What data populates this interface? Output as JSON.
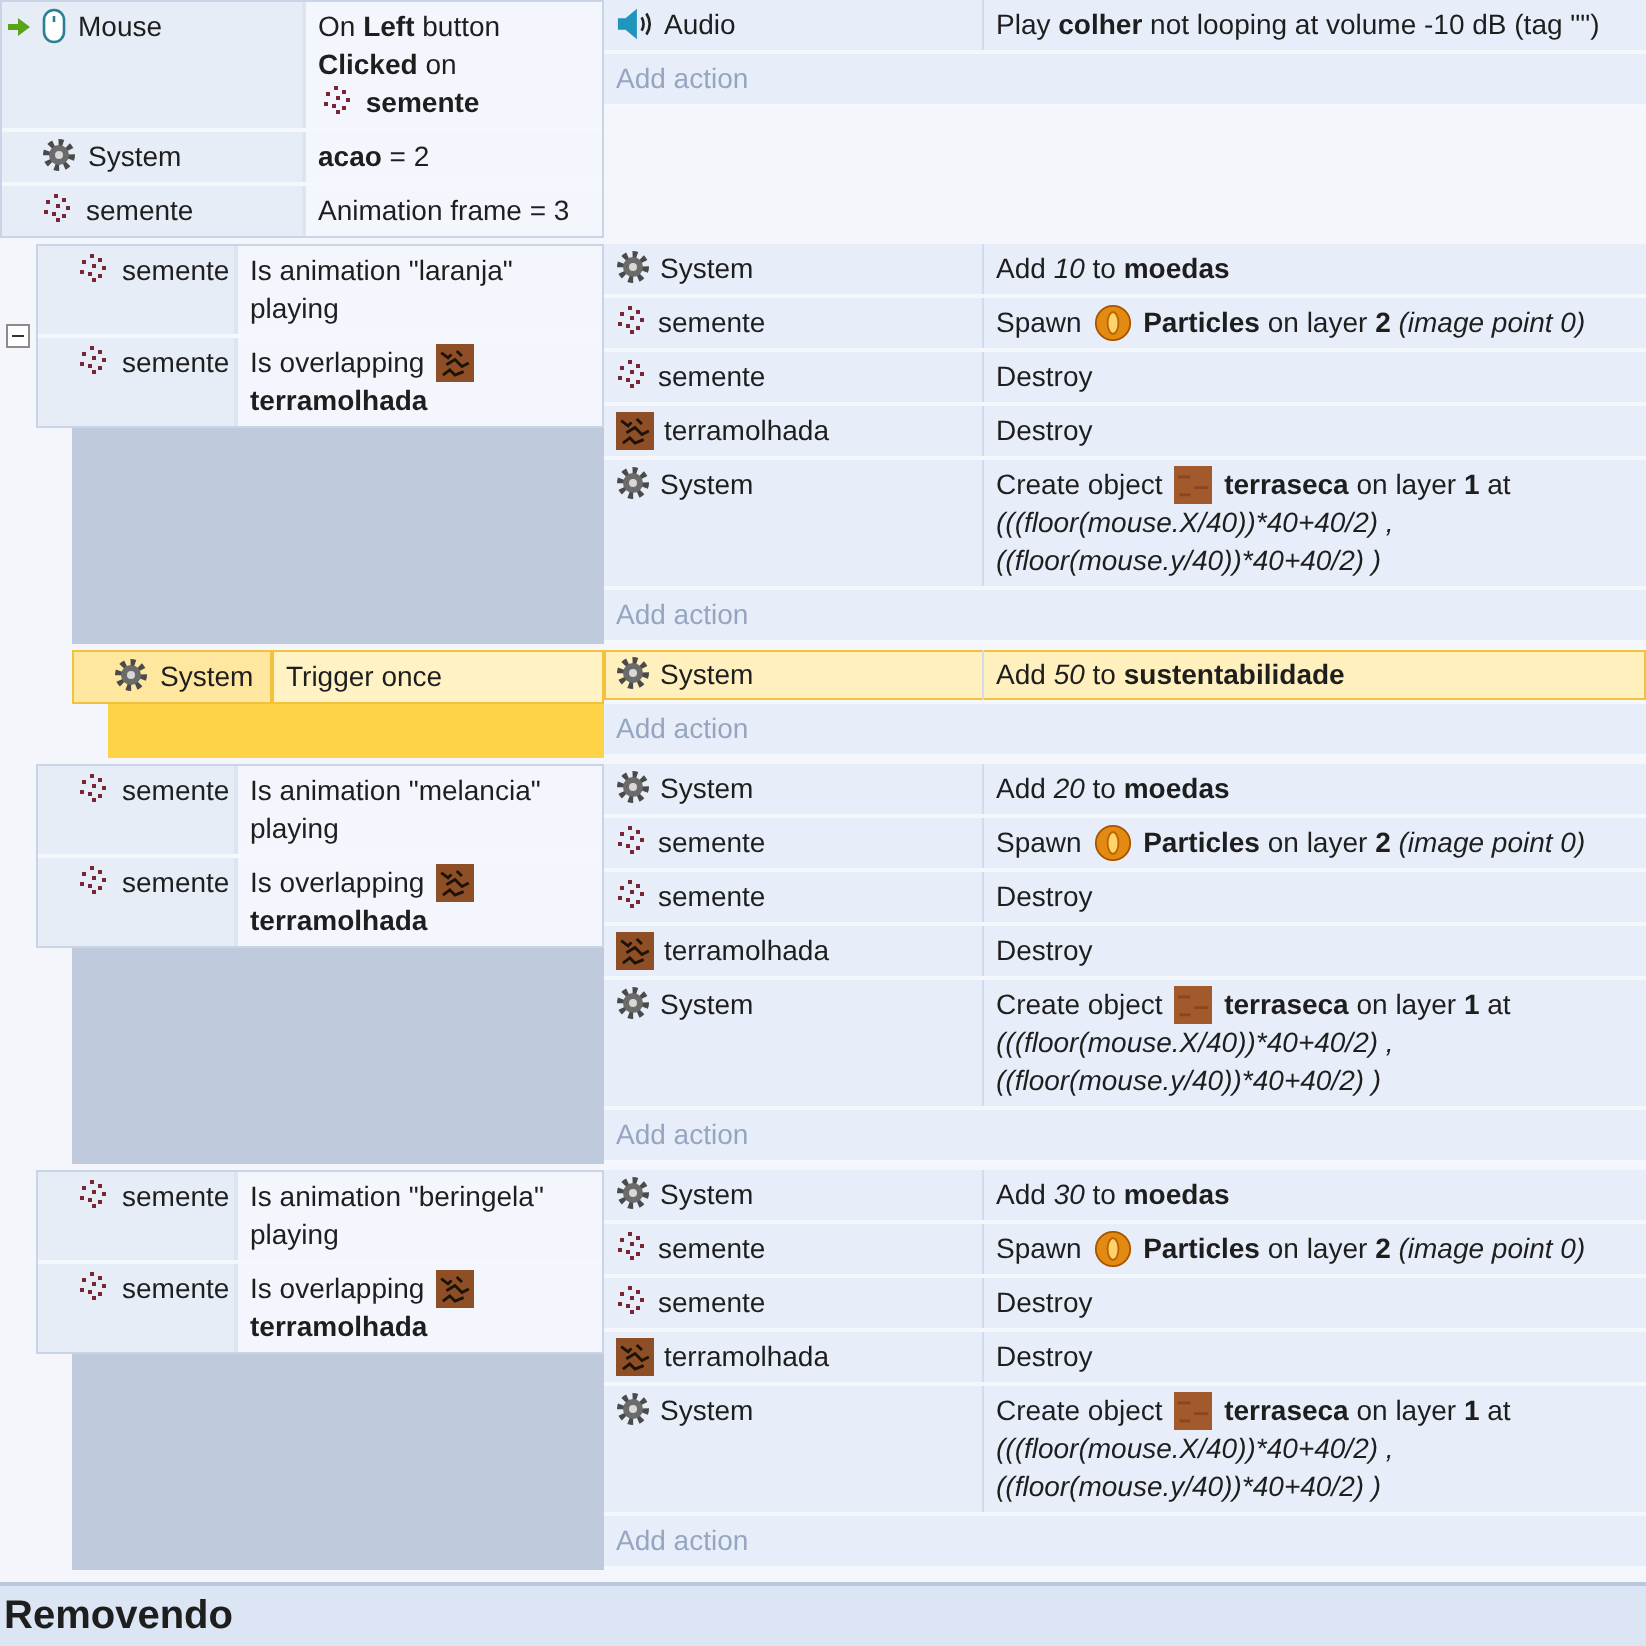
{
  "events": [
    {
      "selected": false,
      "conditions": [
        {
          "kind": "mouse",
          "trigger": true,
          "object": "Mouse",
          "parts": [
            {
              "kind": "text",
              "text": "On **Left** button **Clicked** on"
            },
            {
              "kind": "sprite"
            },
            {
              "kind": "ref",
              "text": "semente"
            }
          ]
        },
        {
          "kind": "system",
          "trigger": false,
          "object": "System",
          "parts": [
            {
              "kind": "text",
              "text": "**acao** = 2"
            }
          ]
        },
        {
          "kind": "sprite",
          "trigger": false,
          "object": "semente",
          "parts": [
            {
              "kind": "text",
              "text": "Animation frame = 3"
            }
          ]
        }
      ],
      "actions": [
        {
          "kind": "audio",
          "object": "Audio",
          "parts": [
            {
              "kind": "text",
              "text": "Play **colher** not looping at volume -10 dB (tag \"\")"
            }
          ]
        }
      ],
      "add_action": "Add action",
      "children": [
        {
          "selected": false,
          "expanded": true,
          "conditions": [
            {
              "kind": "sprite",
              "trigger": false,
              "object": "semente",
              "parts": [
                {
                  "kind": "text",
                  "text": "Is animation \"laranja\" playing"
                }
              ]
            },
            {
              "kind": "sprite",
              "trigger": false,
              "object": "semente",
              "parts": [
                {
                  "kind": "text",
                  "text": "Is overlapping"
                },
                {
                  "kind": "soil"
                },
                {
                  "kind": "ref",
                  "text": "terramolhada"
                }
              ]
            }
          ],
          "actions": [
            {
              "kind": "system",
              "object": "System",
              "parts": [
                {
                  "kind": "text",
                  "text": "Add *10* to **moedas**"
                }
              ]
            },
            {
              "kind": "sprite",
              "object": "semente",
              "parts": [
                {
                  "kind": "text",
                  "text": "Spawn"
                },
                {
                  "kind": "coin"
                },
                {
                  "kind": "text",
                  "text": "**Particles** on layer **2** *(image point 0)*"
                }
              ]
            },
            {
              "kind": "sprite",
              "object": "semente",
              "parts": [
                {
                  "kind": "text",
                  "text": "Destroy"
                }
              ]
            },
            {
              "kind": "soil",
              "object": "terramolhada",
              "parts": [
                {
                  "kind": "text",
                  "text": "Destroy"
                }
              ]
            },
            {
              "kind": "system",
              "object": "System",
              "parts": [
                {
                  "kind": "text",
                  "text": "Create object"
                },
                {
                  "kind": "dirt"
                },
                {
                  "kind": "text",
                  "text": "**terraseca** on layer **1** at"
                },
                {
                  "kind": "expr",
                  "text": "(((floor(mouse.X/40))*40+40/2)  , ((floor(mouse.y/40))*40+40/2)  )"
                }
              ]
            }
          ],
          "add_action": "Add action",
          "children": [
            {
              "selected": true,
              "conditions": [
                {
                  "kind": "system",
                  "trigger": false,
                  "object": "System",
                  "parts": [
                    {
                      "kind": "text",
                      "text": "Trigger once"
                    }
                  ]
                }
              ],
              "actions": [
                {
                  "kind": "system",
                  "object": "System",
                  "parts": [
                    {
                      "kind": "text",
                      "text": "Add *50* to **sustentabilidade**"
                    }
                  ]
                }
              ],
              "add_action": "Add action"
            }
          ]
        },
        {
          "selected": false,
          "conditions": [
            {
              "kind": "sprite",
              "trigger": false,
              "object": "semente",
              "parts": [
                {
                  "kind": "text",
                  "text": "Is animation \"melancia\" playing"
                }
              ]
            },
            {
              "kind": "sprite",
              "trigger": false,
              "object": "semente",
              "parts": [
                {
                  "kind": "text",
                  "text": "Is overlapping"
                },
                {
                  "kind": "soil"
                },
                {
                  "kind": "ref",
                  "text": "terramolhada"
                }
              ]
            }
          ],
          "actions": [
            {
              "kind": "system",
              "object": "System",
              "parts": [
                {
                  "kind": "text",
                  "text": "Add *20* to **moedas**"
                }
              ]
            },
            {
              "kind": "sprite",
              "object": "semente",
              "parts": [
                {
                  "kind": "text",
                  "text": "Spawn"
                },
                {
                  "kind": "coin"
                },
                {
                  "kind": "text",
                  "text": "**Particles** on layer **2** *(image point 0)*"
                }
              ]
            },
            {
              "kind": "sprite",
              "object": "semente",
              "parts": [
                {
                  "kind": "text",
                  "text": "Destroy"
                }
              ]
            },
            {
              "kind": "soil",
              "object": "terramolhada",
              "parts": [
                {
                  "kind": "text",
                  "text": "Destroy"
                }
              ]
            },
            {
              "kind": "system",
              "object": "System",
              "parts": [
                {
                  "kind": "text",
                  "text": "Create object"
                },
                {
                  "kind": "dirt"
                },
                {
                  "kind": "text",
                  "text": "**terraseca** on layer **1** at"
                },
                {
                  "kind": "expr",
                  "text": "(((floor(mouse.X/40))*40+40/2)  , ((floor(mouse.y/40))*40+40/2)  )"
                }
              ]
            }
          ],
          "add_action": "Add action"
        },
        {
          "selected": false,
          "conditions": [
            {
              "kind": "sprite",
              "trigger": false,
              "object": "semente",
              "parts": [
                {
                  "kind": "text",
                  "text": "Is animation \"beringela\" playing"
                }
              ]
            },
            {
              "kind": "sprite",
              "trigger": false,
              "object": "semente",
              "parts": [
                {
                  "kind": "text",
                  "text": "Is overlapping"
                },
                {
                  "kind": "soil"
                },
                {
                  "kind": "ref",
                  "text": "terramolhada"
                }
              ]
            }
          ],
          "actions": [
            {
              "kind": "system",
              "object": "System",
              "parts": [
                {
                  "kind": "text",
                  "text": "Add *30* to **moedas**"
                }
              ]
            },
            {
              "kind": "sprite",
              "object": "semente",
              "parts": [
                {
                  "kind": "text",
                  "text": "Spawn"
                },
                {
                  "kind": "coin"
                },
                {
                  "kind": "text",
                  "text": "**Particles** on layer **2** *(image point 0)*"
                }
              ]
            },
            {
              "kind": "sprite",
              "object": "semente",
              "parts": [
                {
                  "kind": "text",
                  "text": "Destroy"
                }
              ]
            },
            {
              "kind": "soil",
              "object": "terramolhada",
              "parts": [
                {
                  "kind": "text",
                  "text": "Destroy"
                }
              ]
            },
            {
              "kind": "system",
              "object": "System",
              "parts": [
                {
                  "kind": "text",
                  "text": "Create object"
                },
                {
                  "kind": "dirt"
                },
                {
                  "kind": "text",
                  "text": "**terraseca** on layer **1** at"
                },
                {
                  "kind": "expr",
                  "text": "(((floor(mouse.X/40))*40+40/2)  , ((floor(mouse.y/40))*40+40/2)  )"
                }
              ]
            }
          ],
          "add_action": "Add action"
        }
      ]
    }
  ],
  "next_group": {
    "title": "Removendo"
  }
}
